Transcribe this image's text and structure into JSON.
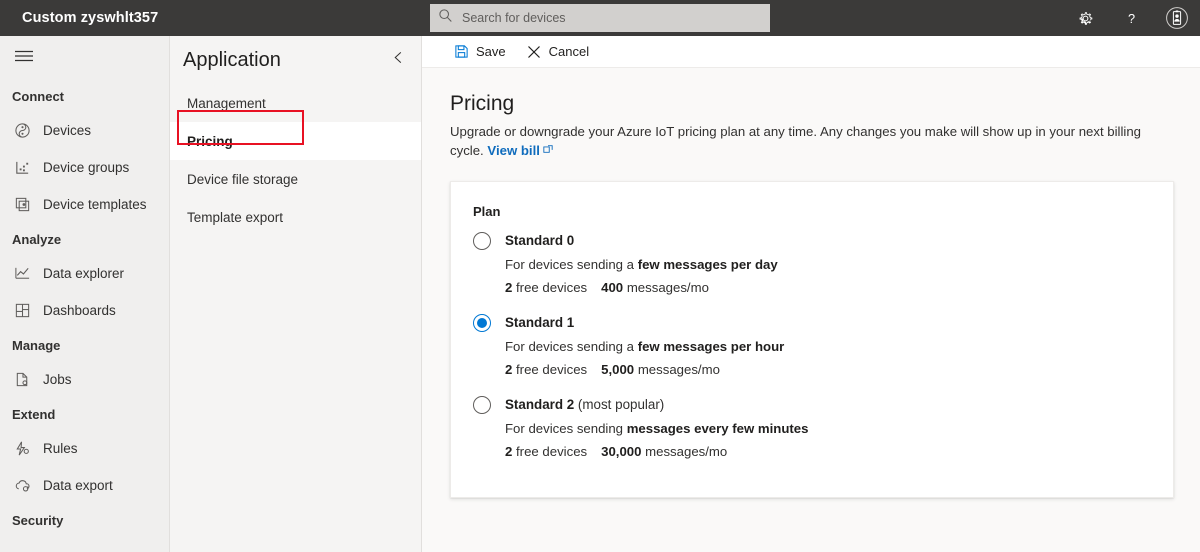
{
  "header": {
    "title": "Custom zyswhlt357",
    "search": {
      "placeholder": "Search for devices",
      "value": "",
      "icon": "search-icon"
    },
    "actions": [
      {
        "name": "settings-button",
        "icon": "gear-icon"
      },
      {
        "name": "help-button",
        "icon": "question-mark-icon"
      },
      {
        "name": "account-button",
        "icon": "user-badge-icon"
      }
    ],
    "background_color": "#3b3a39"
  },
  "leftnav": {
    "hamburger_icon": "hamburger-menu-icon",
    "groups": [
      {
        "label": "Connect",
        "items": [
          {
            "label": "Devices",
            "icon": "devices-icon"
          },
          {
            "label": "Device groups",
            "icon": "device-groups-icon"
          },
          {
            "label": "Device templates",
            "icon": "device-templates-icon"
          }
        ]
      },
      {
        "label": "Analyze",
        "items": [
          {
            "label": "Data explorer",
            "icon": "line-chart-icon"
          },
          {
            "label": "Dashboards",
            "icon": "dashboard-grid-icon"
          }
        ]
      },
      {
        "label": "Manage",
        "items": [
          {
            "label": "Jobs",
            "icon": "jobs-document-icon"
          }
        ]
      },
      {
        "label": "Extend",
        "items": [
          {
            "label": "Rules",
            "icon": "rules-bolt-icon"
          },
          {
            "label": "Data export",
            "icon": "cloud-export-icon"
          }
        ]
      },
      {
        "label": "Security",
        "items": []
      }
    ]
  },
  "panel": {
    "title": "Application",
    "collapse_icon": "chevron-left-icon",
    "items": [
      {
        "label": "Management",
        "selected": false
      },
      {
        "label": "Pricing",
        "selected": true
      },
      {
        "label": "Device file storage",
        "selected": false
      },
      {
        "label": "Template export",
        "selected": false
      }
    ],
    "annotation_color": "#e81123"
  },
  "commandbar": {
    "save": {
      "label": "Save",
      "icon": "save-floppy-icon"
    },
    "cancel": {
      "label": "Cancel",
      "icon": "close-x-icon"
    }
  },
  "page": {
    "title": "Pricing",
    "description": "Upgrade or downgrade your Azure IoT pricing plan at any time. Any changes you make will show up in your next billing cycle.",
    "link_label": "View bill",
    "link_icon": "external-link-icon",
    "link_color": "#0f6cbd"
  },
  "plan_card": {
    "label": "Plan",
    "selected_plan": "Standard 1",
    "accent_color": "#0078d4",
    "plans": [
      {
        "name": "Standard 0",
        "suffix": "",
        "selected": false,
        "desc_prefix": "For devices sending a ",
        "desc_bold": "few messages per day",
        "free_devices_count": "2",
        "free_devices_label": "free devices",
        "messages_count": "400",
        "messages_label": "messages/mo"
      },
      {
        "name": "Standard 1",
        "suffix": "",
        "selected": true,
        "desc_prefix": "For devices sending a ",
        "desc_bold": "few messages per hour",
        "free_devices_count": "2",
        "free_devices_label": "free devices",
        "messages_count": "5,000",
        "messages_label": "messages/mo"
      },
      {
        "name": "Standard 2",
        "suffix": " (most popular)",
        "selected": false,
        "desc_prefix": "For devices sending ",
        "desc_bold": "messages every few minutes",
        "free_devices_count": "2",
        "free_devices_label": "free devices",
        "messages_count": "30,000",
        "messages_label": "messages/mo"
      }
    ]
  }
}
